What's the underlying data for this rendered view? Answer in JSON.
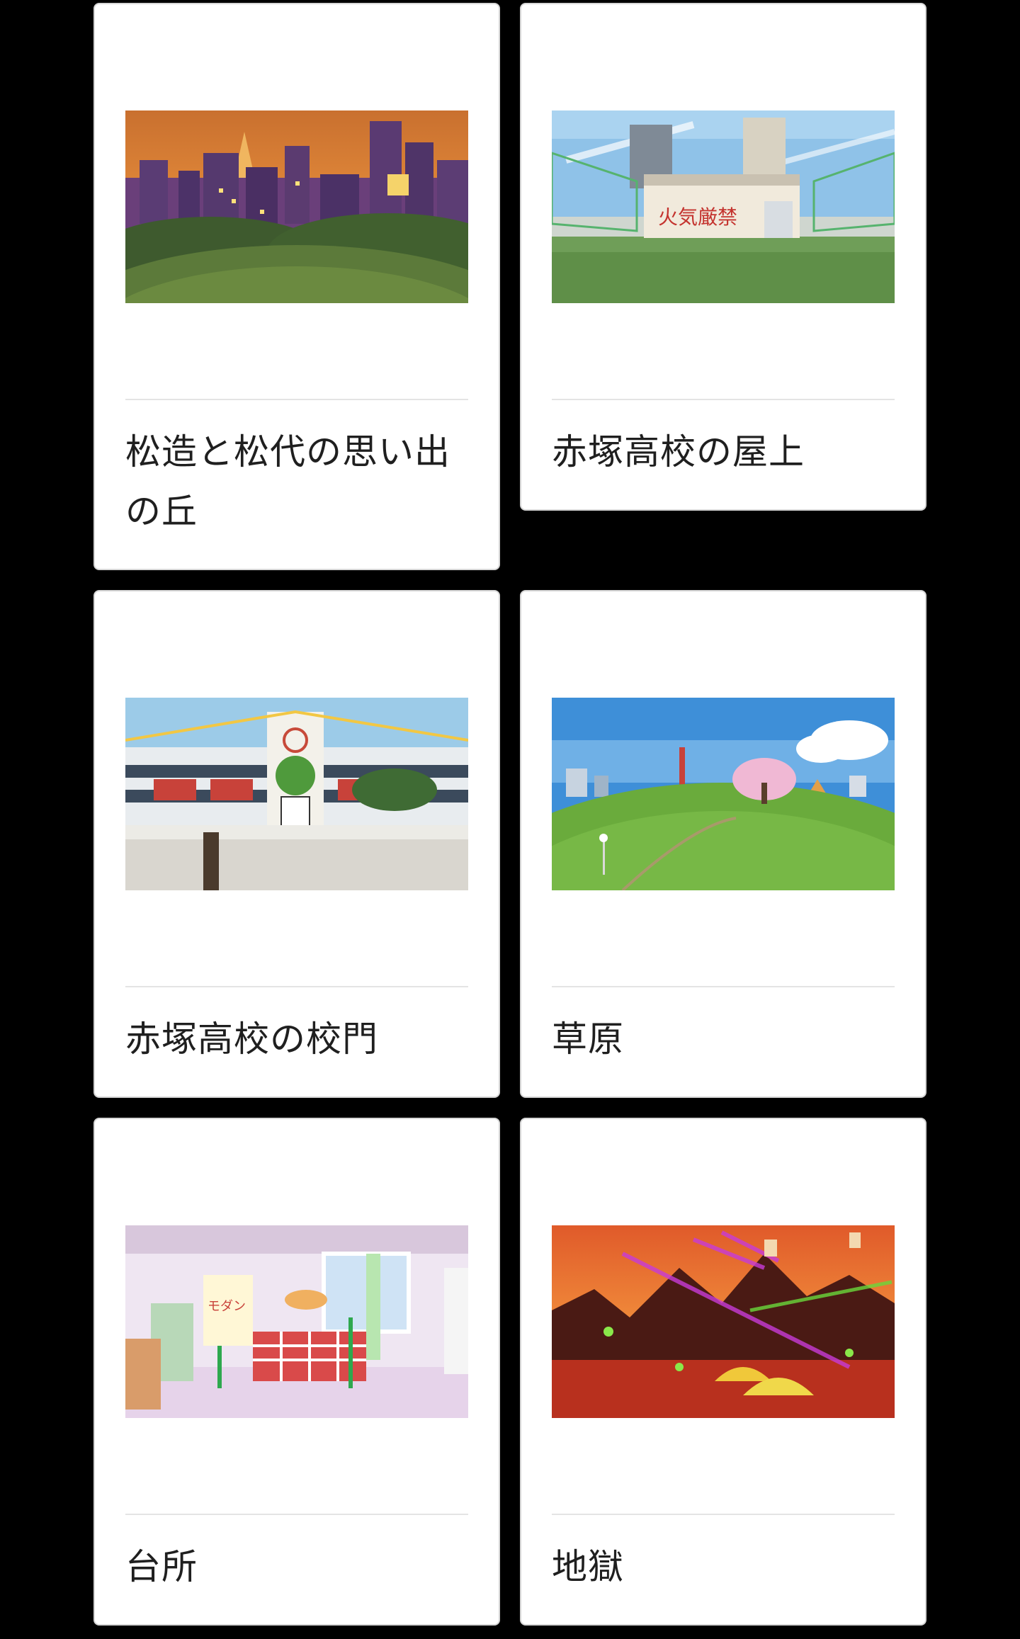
{
  "cards": [
    {
      "title": "松造と松代の思い出の丘"
    },
    {
      "title": "赤塚高校の屋上",
      "image_text": "火気厳禁"
    },
    {
      "title": "赤塚高校の校門"
    },
    {
      "title": "草原"
    },
    {
      "title": "台所",
      "image_text": "モダン"
    },
    {
      "title": "地獄"
    }
  ]
}
